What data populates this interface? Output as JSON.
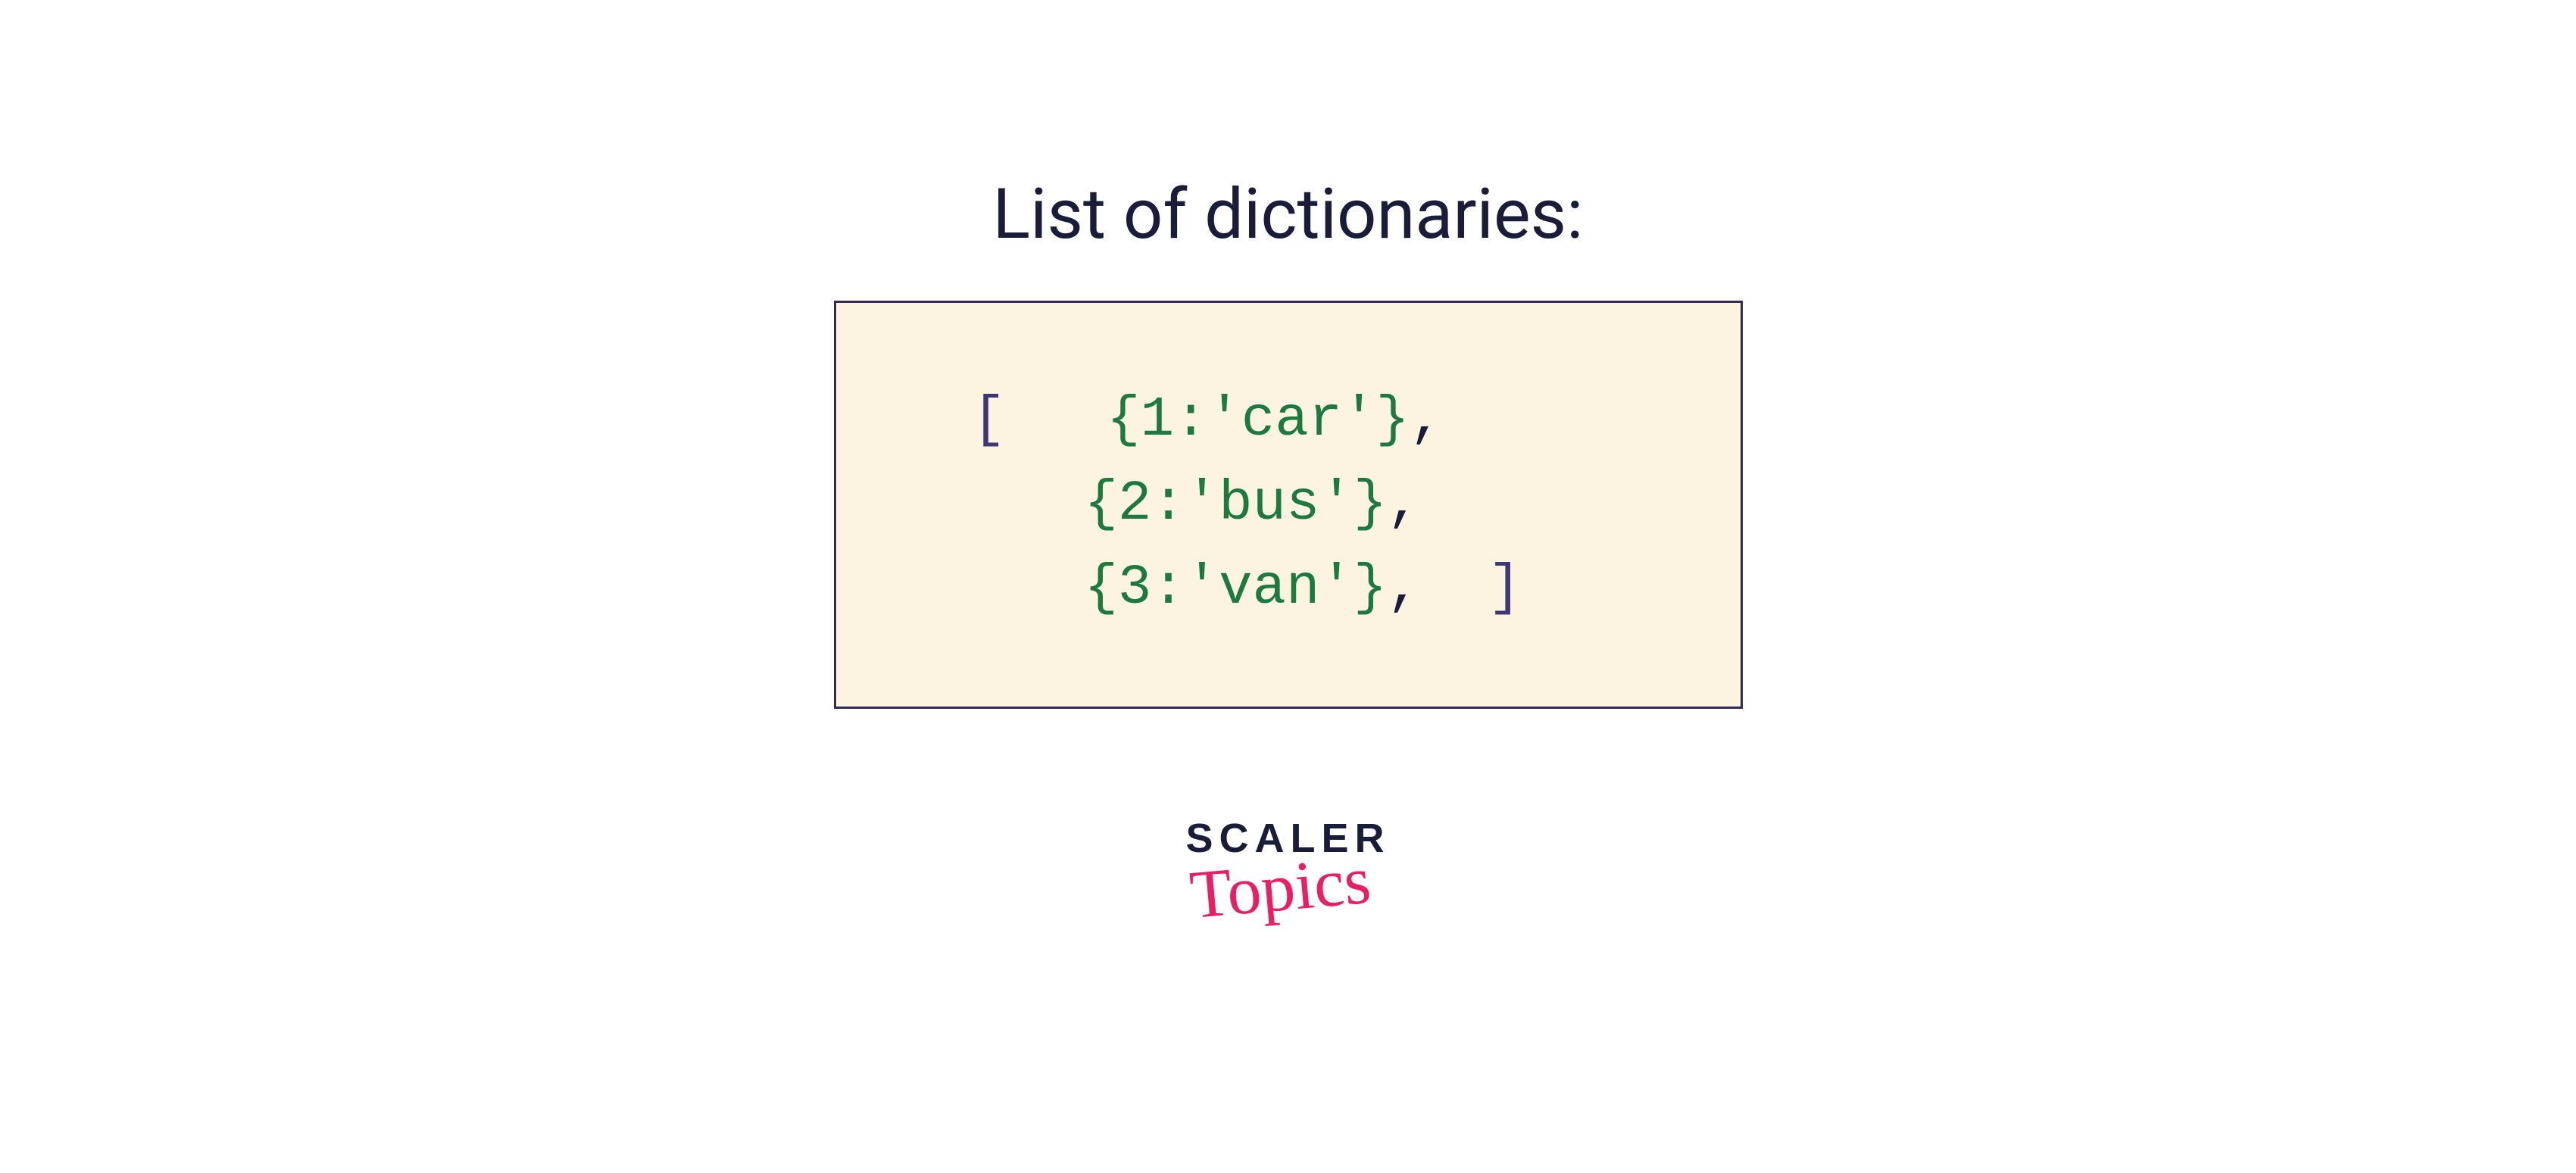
{
  "title": "List of dictionaries:",
  "code": {
    "open_bracket": "[",
    "close_bracket": "]",
    "lines": [
      {
        "dict": "{1:'car'}",
        "comma": ","
      },
      {
        "dict": "{2:'bus'}",
        "comma": ","
      },
      {
        "dict": "{3:'van'}",
        "comma": ","
      }
    ]
  },
  "logo": {
    "main": "SCALER",
    "sub": "Topics"
  }
}
